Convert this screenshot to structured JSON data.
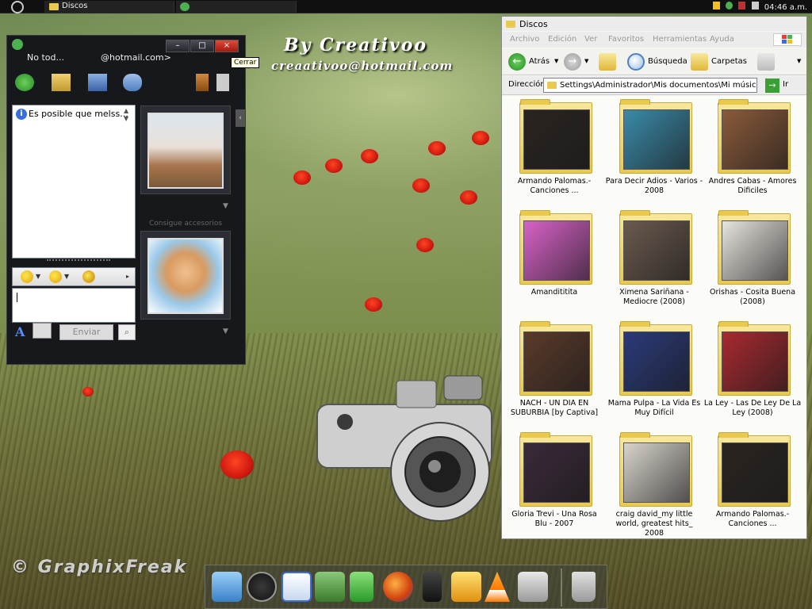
{
  "taskbar": {
    "active_task": "Discos",
    "clock": "04:46 a.m."
  },
  "watermarks": {
    "title": "By Creativoo",
    "email": "creaativoo@hotmail.com",
    "credit": "© GraphixFreak"
  },
  "messenger": {
    "contact_name": "No tod...",
    "contact_email": "@hotmail.com>",
    "tooltip": "Cerrar",
    "message_preview": "Es posible que melss...",
    "send_label": "Enviar",
    "font_label": "A",
    "accessories_promo": "Consigue accesorios"
  },
  "explorer": {
    "title": "Discos",
    "menu": [
      "Archivo",
      "Edición",
      "Ver",
      "Favoritos",
      "Herramientas",
      "Ayuda"
    ],
    "toolbar": {
      "back": "Atrás",
      "search": "Búsqueda",
      "folders": "Carpetas"
    },
    "address_label": "Dirección",
    "address_path": "Settings\\Administrador\\Mis documentos\\Mi música\\Discos",
    "go_label": "Ir",
    "folders": [
      {
        "name": "Armando Palomas.-Canciones ...",
        "color": "#2a2420"
      },
      {
        "name": "Para Decir Adios - Varios - 2008",
        "color": "#3a8aa8"
      },
      {
        "name": "Andres Cabas - Amores Dificiles",
        "color": "#8a5a3a"
      },
      {
        "name": "Amandititita",
        "color": "#d862c8"
      },
      {
        "name": "Ximena Sariñana - Mediocre (2008)",
        "color": "#6a5a4e"
      },
      {
        "name": "Orishas - Cosita Buena (2008)",
        "color": "#e8e4de"
      },
      {
        "name": "NACH - UN DIA EN SUBURBIA [by Captiva]",
        "color": "#5a3a2a"
      },
      {
        "name": "Mama Pulpa - La Vida Es Muy Difícil",
        "color": "#2a3a7a"
      },
      {
        "name": "La Ley - Las De Ley De La Ley (2008)",
        "color": "#a82a30"
      },
      {
        "name": "Gloria Trevi - Una Rosa Blu - 2007",
        "color": "#3a2a3a"
      },
      {
        "name": "craig david_my little world, greatest hits_ 2008",
        "color": "#d8d4cc"
      },
      {
        "name": "Armando Palomas.-Canciones ...",
        "color": "#2a2420"
      }
    ]
  },
  "dock": {
    "icons": [
      "download-icon",
      "music-player-icon",
      "notepad-icon",
      "image-viewer-icon",
      "green-file-icon",
      "firefox-icon",
      "media-player-icon",
      "folder-icon",
      "vlc-icon",
      "system-tools-icon",
      "trash-icon"
    ]
  }
}
